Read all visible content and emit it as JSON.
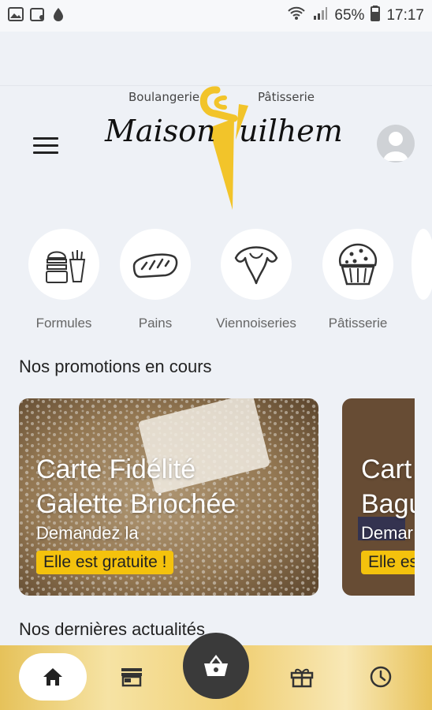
{
  "status_bar": {
    "battery": "65%",
    "time": "17:17",
    "left_icons": [
      "image-icon",
      "calendar-icon",
      "drop-icon"
    ],
    "right_icons": [
      "wifi-icon",
      "signal-icon",
      "battery-icon"
    ]
  },
  "header": {
    "logo_small_left": "Boulangerie",
    "logo_small_right": "Pâtisserie",
    "logo_word_left": "Maison",
    "logo_word_right": "uilhem",
    "brand_color": "#f2c42a"
  },
  "categories": [
    {
      "label": "Formules",
      "icon": "burger-meal-icon"
    },
    {
      "label": "Pains",
      "icon": "bread-icon"
    },
    {
      "label": "Viennoiseries",
      "icon": "croissant-icon"
    },
    {
      "label": "Pâtisserie",
      "icon": "muffin-icon"
    }
  ],
  "promotions": {
    "title": "Nos promotions en cours",
    "cards": [
      {
        "title_line1": "Carte Fidélité",
        "title_line2": "Galette Briochée",
        "subtitle": "Demandez la",
        "badge": "Elle est gratuite !"
      },
      {
        "title_line1": "Cart",
        "title_line2": "Bagu",
        "subtitle": "Demar",
        "badge": "Elle es"
      }
    ]
  },
  "news": {
    "title": "Nos dernières actualités"
  },
  "bottom_nav": {
    "items": [
      "home-icon",
      "store-icon",
      "basket-icon",
      "gift-icon",
      "clock-icon"
    ],
    "center_color": "#3a3a3a"
  },
  "colors": {
    "accent_yellow": "#f4c20d",
    "background": "#eef1f6"
  }
}
